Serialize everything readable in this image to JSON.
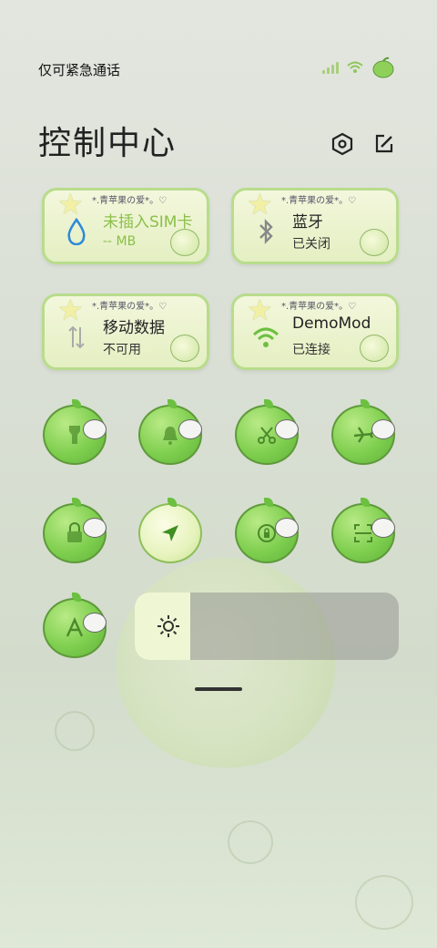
{
  "status_bar": {
    "text": "仅可紧急通话",
    "wifi_icon": "wifi-icon",
    "signal_icon": "signal-icon",
    "apple_icon": "apple-icon"
  },
  "header": {
    "title": "控制中心",
    "settings_icon": "settings-hex-icon",
    "edit_icon": "edit-icon"
  },
  "cards": [
    {
      "tag": "*.青苹果の爱*。♡",
      "main": "未插入SIM卡",
      "sub": "-- MB",
      "icon": "droplet-icon"
    },
    {
      "tag": "*.青苹果の爱*。♡",
      "main": "蓝牙",
      "sub": "已关闭",
      "icon": "bluetooth-icon"
    },
    {
      "tag": "*.青苹果の爱*。♡",
      "main": "移动数据",
      "sub": "不可用",
      "icon": "mobile-data-icon"
    },
    {
      "tag": "*.青苹果の爱*。♡",
      "main": "DemoMod",
      "sub": "已连接",
      "icon": "wifi-icon"
    }
  ],
  "toggles": [
    {
      "name": "flashlight",
      "icon": "flashlight-icon"
    },
    {
      "name": "sound",
      "icon": "bell-icon"
    },
    {
      "name": "screenshot",
      "icon": "scissors-icon"
    },
    {
      "name": "airplane",
      "icon": "airplane-icon"
    },
    {
      "name": "lock-screen",
      "icon": "lock-icon"
    },
    {
      "name": "location",
      "icon": "location-arrow-icon"
    },
    {
      "name": "rotation-lock",
      "icon": "rotation-lock-icon"
    },
    {
      "name": "scan",
      "icon": "scan-icon"
    },
    {
      "name": "auto-brightness",
      "icon": "letter-a-icon"
    }
  ],
  "brightness": {
    "icon": "sun-icon",
    "level": 0.21
  },
  "colors": {
    "accent": "#7fcf4f",
    "card_border": "#b8dc8c"
  }
}
